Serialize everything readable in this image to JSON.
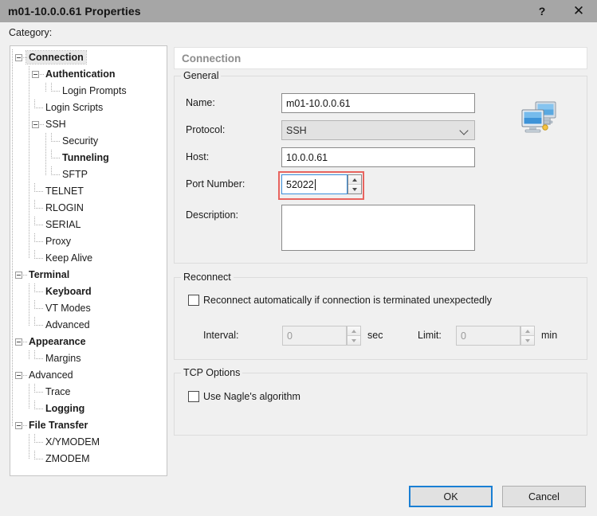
{
  "window": {
    "title": "m01-10.0.0.61 Properties",
    "help_button": "?",
    "close_button": "✕"
  },
  "category": {
    "label": "Category:",
    "tree": [
      {
        "label": "Connection",
        "depth": 0,
        "bold": true,
        "expander": true,
        "selected": true
      },
      {
        "label": "Authentication",
        "depth": 1,
        "bold": true,
        "expander": true,
        "selected": false
      },
      {
        "label": "Login Prompts",
        "depth": 2,
        "bold": false,
        "expander": false,
        "selected": false
      },
      {
        "label": "Login Scripts",
        "depth": 1,
        "bold": false,
        "expander": false,
        "selected": false
      },
      {
        "label": "SSH",
        "depth": 1,
        "bold": false,
        "expander": true,
        "selected": false
      },
      {
        "label": "Security",
        "depth": 2,
        "bold": false,
        "expander": false,
        "selected": false
      },
      {
        "label": "Tunneling",
        "depth": 2,
        "bold": true,
        "expander": false,
        "selected": false
      },
      {
        "label": "SFTP",
        "depth": 2,
        "bold": false,
        "expander": false,
        "selected": false
      },
      {
        "label": "TELNET",
        "depth": 1,
        "bold": false,
        "expander": false,
        "selected": false
      },
      {
        "label": "RLOGIN",
        "depth": 1,
        "bold": false,
        "expander": false,
        "selected": false
      },
      {
        "label": "SERIAL",
        "depth": 1,
        "bold": false,
        "expander": false,
        "selected": false
      },
      {
        "label": "Proxy",
        "depth": 1,
        "bold": false,
        "expander": false,
        "selected": false
      },
      {
        "label": "Keep Alive",
        "depth": 1,
        "bold": false,
        "expander": false,
        "selected": false
      },
      {
        "label": "Terminal",
        "depth": 0,
        "bold": true,
        "expander": true,
        "selected": false
      },
      {
        "label": "Keyboard",
        "depth": 1,
        "bold": true,
        "expander": false,
        "selected": false
      },
      {
        "label": "VT Modes",
        "depth": 1,
        "bold": false,
        "expander": false,
        "selected": false
      },
      {
        "label": "Advanced",
        "depth": 1,
        "bold": false,
        "expander": false,
        "selected": false
      },
      {
        "label": "Appearance",
        "depth": 0,
        "bold": true,
        "expander": true,
        "selected": false
      },
      {
        "label": "Margins",
        "depth": 1,
        "bold": false,
        "expander": false,
        "selected": false
      },
      {
        "label": "Advanced",
        "depth": 0,
        "bold": false,
        "expander": true,
        "selected": false
      },
      {
        "label": "Trace",
        "depth": 1,
        "bold": false,
        "expander": false,
        "selected": false
      },
      {
        "label": "Logging",
        "depth": 1,
        "bold": true,
        "expander": false,
        "selected": false
      },
      {
        "label": "File Transfer",
        "depth": 0,
        "bold": true,
        "expander": true,
        "selected": false
      },
      {
        "label": "X/YMODEM",
        "depth": 1,
        "bold": false,
        "expander": false,
        "selected": false
      },
      {
        "label": "ZMODEM",
        "depth": 1,
        "bold": false,
        "expander": false,
        "selected": false
      }
    ]
  },
  "page": {
    "header": "Connection",
    "general": {
      "title": "General",
      "name_label": "Name:",
      "name_value": "m01-10.0.0.61",
      "protocol_label": "Protocol:",
      "protocol_value": "SSH",
      "host_label": "Host:",
      "host_value": "10.0.0.61",
      "port_label": "Port Number:",
      "port_value": "52022",
      "description_label": "Description:",
      "description_value": "",
      "icon": "network-computers-icon"
    },
    "reconnect": {
      "title": "Reconnect",
      "auto_label": "Reconnect automatically if connection is terminated unexpectedly",
      "auto_checked": false,
      "interval_label": "Interval:",
      "interval_value": "0",
      "interval_unit": "sec",
      "limit_label": "Limit:",
      "limit_value": "0",
      "limit_unit": "min"
    },
    "tcp": {
      "title": "TCP Options",
      "nagle_label": "Use Nagle's algorithm",
      "nagle_checked": false
    }
  },
  "footer": {
    "ok_label": "OK",
    "cancel_label": "Cancel"
  },
  "colors": {
    "titlebar": "#a6a6a6",
    "dialog_bg": "#f0f0f0",
    "accent_focus": "#3a8edb",
    "default_button_border": "#1a7fd4",
    "annotation_red": "#e8645f"
  }
}
